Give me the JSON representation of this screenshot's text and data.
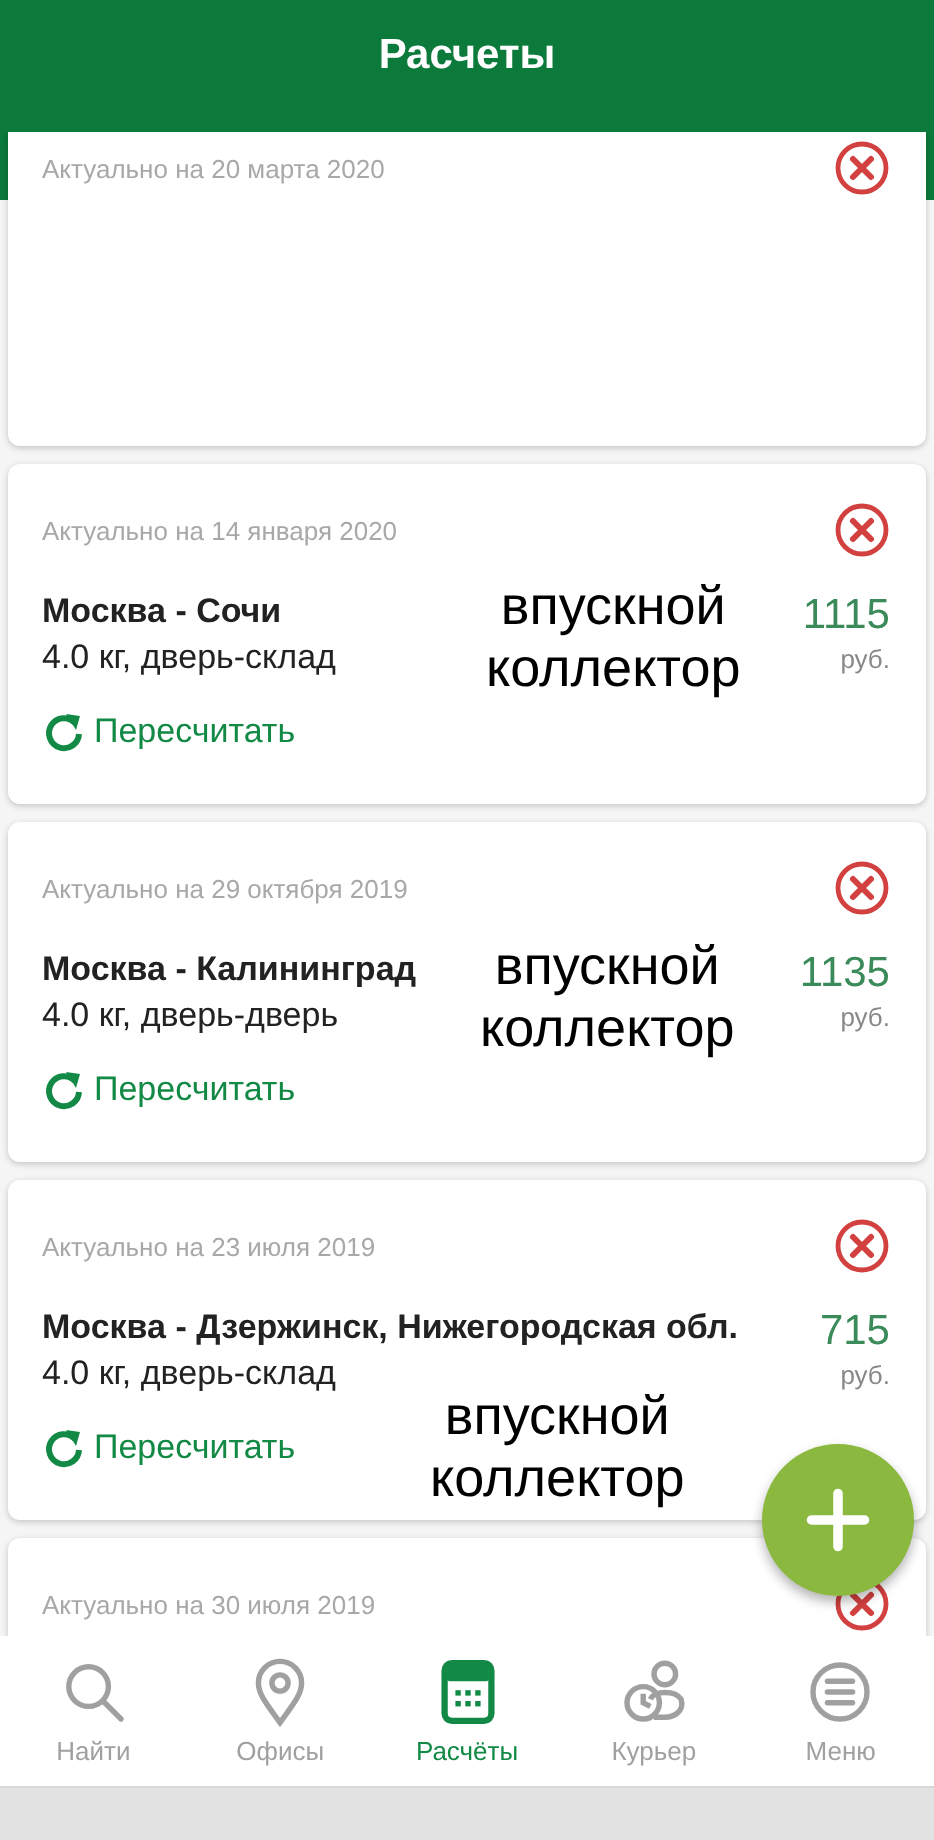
{
  "header": {
    "title": "Расчеты"
  },
  "cards": [
    {
      "date": "Актуально на 20 марта 2020"
    },
    {
      "date": "Актуально на 14 января 2020",
      "route": "Москва - Сочи",
      "details": "4.0 кг, дверь-склад",
      "price": "1115",
      "currency": "руб.",
      "action": "Пересчитать"
    },
    {
      "date": "Актуально на 29 октября 2019",
      "route": "Москва - Калининград",
      "details": "4.0 кг, дверь-дверь",
      "price": "1135",
      "currency": "руб.",
      "action": "Пересчитать"
    },
    {
      "date": "Актуально на 23 июля 2019",
      "route": "Москва - Дзержинск, Нижегородская обл.",
      "details": "4.0 кг, дверь-склад",
      "price": "715",
      "currency": "руб.",
      "action": "Пересчитать"
    },
    {
      "date": "Актуально на 30 июля 2019"
    }
  ],
  "overlay_captions": [
    {
      "lines": [
        "впускной",
        "коллектор"
      ]
    },
    {
      "lines": [
        "впускной",
        "коллектор"
      ]
    },
    {
      "lines": [
        "впускной",
        "коллектор"
      ]
    }
  ],
  "nav": [
    {
      "label": "Найти",
      "selected": false
    },
    {
      "label": "Офисы",
      "selected": false
    },
    {
      "label": "Расчёты",
      "selected": true
    },
    {
      "label": "Курьер",
      "selected": false
    },
    {
      "label": "Меню",
      "selected": false
    }
  ]
}
